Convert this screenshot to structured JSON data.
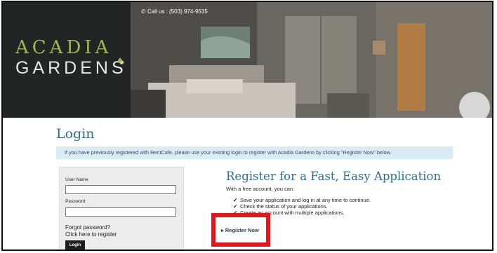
{
  "header": {
    "call_us": "Call us : (503) 974-9535",
    "logo_line1": "ACADIA",
    "logo_line2": "GARDENS"
  },
  "page": {
    "title": "Login",
    "notice": "If you have previously registered with RentCafe, please use your existing login to register with Acadia Gardens by clicking \"Register Now\" below."
  },
  "login_form": {
    "username_label": "User Name",
    "username_value": "",
    "password_label": "Password",
    "password_value": "",
    "forgot_password": "Forgot password?",
    "register_link": "Click here to register",
    "login_button": "Login"
  },
  "register": {
    "title": "Register for a Fast, Easy Application",
    "subtitle": "With a free account, you can:",
    "benefits": [
      "Save your application and log in at any time to continue.",
      "Check the status of your applications.",
      "Create an account with multiple applications."
    ],
    "register_now": "Register Now"
  },
  "colors": {
    "accent": "#2f6e8e",
    "logo_green": "#9db94a",
    "highlight_red": "#e8141b",
    "notice_bg": "#d9ecf5"
  }
}
